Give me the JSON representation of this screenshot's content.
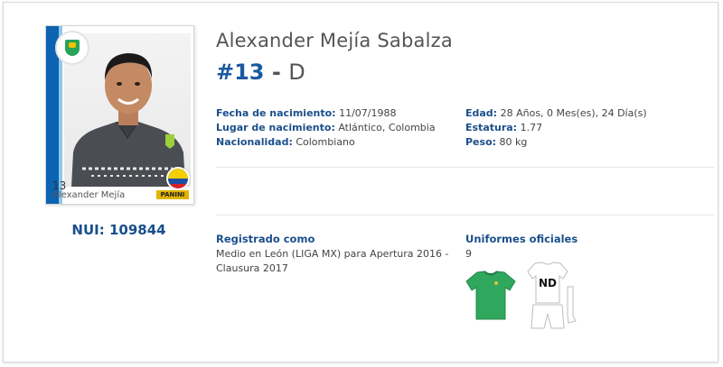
{
  "player": {
    "name": "Alexander Mejía Sabalza",
    "number": "#13",
    "separator": "-",
    "position": "D",
    "nui_label": "NUI:",
    "nui_value": "109844"
  },
  "sticker": {
    "number": "13",
    "name": "Alexander Mejía",
    "brand": "PANINI"
  },
  "details_left": [
    {
      "label": "Fecha de nacimiento:",
      "value": "11/07/1988"
    },
    {
      "label": "Lugar de nacimiento:",
      "value": "Atlántico, Colombia"
    },
    {
      "label": "Nacionalidad:",
      "value": "Colombiano"
    }
  ],
  "details_right": [
    {
      "label": "Edad:",
      "value": "28 Años, 0 Mes(es), 24 Día(s)"
    },
    {
      "label": "Estatura:",
      "value": "1.77"
    },
    {
      "label": "Peso:",
      "value": "80 kg"
    }
  ],
  "registro": {
    "title": "Registrado como",
    "line1": "Medio en León (LIGA MX) para Apertura 2016 -",
    "line2": "Clausura 2017"
  },
  "uniformes": {
    "title": "Uniformes oficiales",
    "number": "9",
    "home_color": "#2fa75d",
    "away_label": "ND"
  },
  "colors": {
    "accent": "#1a4f8b",
    "number_blue": "#1a5aa0"
  }
}
